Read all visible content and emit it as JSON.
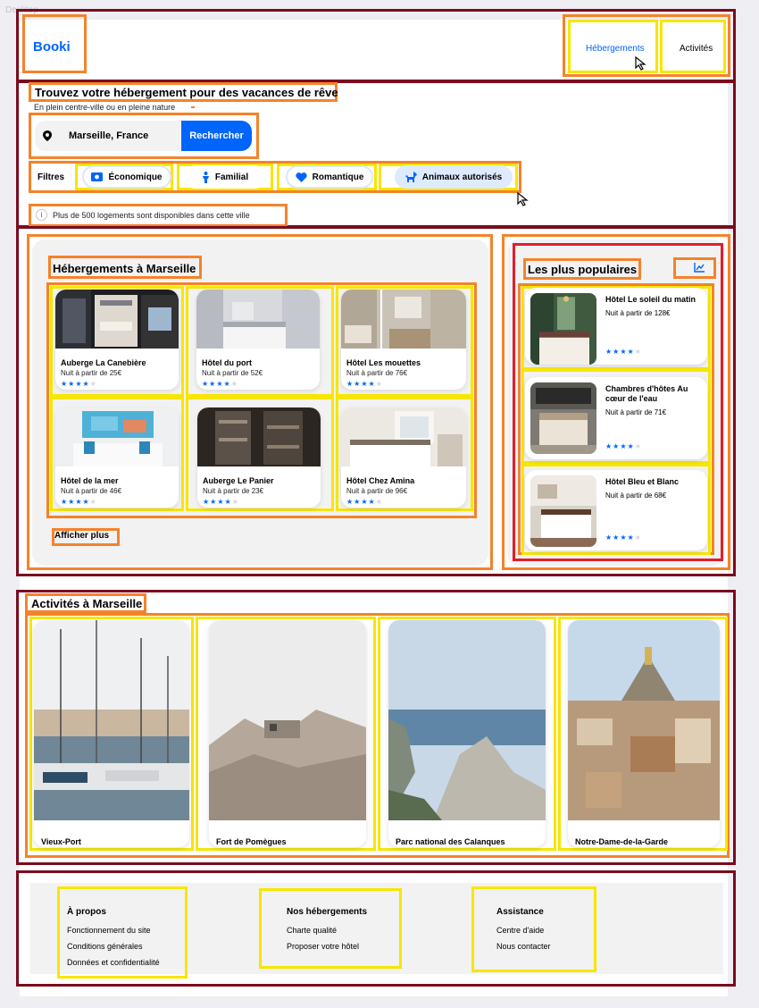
{
  "frame_label": "Desktop",
  "header": {
    "logo": "Booki",
    "nav": [
      "Hébergements",
      "Activités"
    ]
  },
  "search": {
    "title": "Trouvez votre hébergement pour des vacances de rêve",
    "subtitle": "En plein centre-ville ou en pleine nature",
    "value": "Marseille, France",
    "button": "Rechercher"
  },
  "filters": {
    "label": "Filtres",
    "chips": [
      "Économique",
      "Familial",
      "Romantique",
      "Animaux autorisés"
    ]
  },
  "info": "Plus de 500 logements sont disponibles dans cette ville",
  "hebergements": {
    "title": "Hébergements à Marseille",
    "cards": [
      {
        "name": "Auberge La Canebière",
        "price": "Nuit à partir de 25€",
        "stars": 4
      },
      {
        "name": "Hôtel du port",
        "price": "Nuit à partir de 52€",
        "stars": 4
      },
      {
        "name": "Hôtel Les mouettes",
        "price": "Nuit à partir de 76€",
        "stars": 4
      },
      {
        "name": "Hôtel de la mer",
        "price": "Nuit à partir de 46€",
        "stars": 4
      },
      {
        "name": "Auberge Le Panier",
        "price": "Nuit à partir de 23€",
        "stars": 4
      },
      {
        "name": "Hôtel Chez Amina",
        "price": "Nuit à partir de 96€",
        "stars": 4
      }
    ],
    "more": "Afficher plus"
  },
  "populaires": {
    "title": "Les plus populaires",
    "cards": [
      {
        "name": "Hôtel Le soleil du matin",
        "price": "Nuit à partir de 128€",
        "stars": 4
      },
      {
        "name": "Chambres d'hôtes Au cœur de l'eau",
        "price": "Nuit à partir de 71€",
        "stars": 4
      },
      {
        "name": "Hôtel Bleu et Blanc",
        "price": "Nuit à partir de 68€",
        "stars": 4
      }
    ]
  },
  "activites": {
    "title": "Activités à Marseille",
    "cards": [
      "Vieux-Port",
      "Fort de Pomègues",
      "Parc national des Calanques",
      "Notre-Dame-de-la-Garde"
    ]
  },
  "footer": {
    "columns": [
      {
        "title": "À propos",
        "links": [
          "Fonctionnement du site",
          "Conditions générales",
          "Données et confidentialité"
        ]
      },
      {
        "title": "Nos hébergements",
        "links": [
          "Charte qualité",
          "Proposer votre hôtel"
        ]
      },
      {
        "title": "Assistance",
        "links": [
          "Centre d'aide",
          "Nous contacter"
        ]
      }
    ]
  },
  "colors": {
    "accent": "#0065fc",
    "accent_light": "#deebff",
    "panel_grey": "#f2f2f2",
    "annot_maroon": "#7a0b1e",
    "annot_orange": "#f5822a",
    "annot_yellow": "#f7e600",
    "annot_red": "#e11d2a"
  }
}
